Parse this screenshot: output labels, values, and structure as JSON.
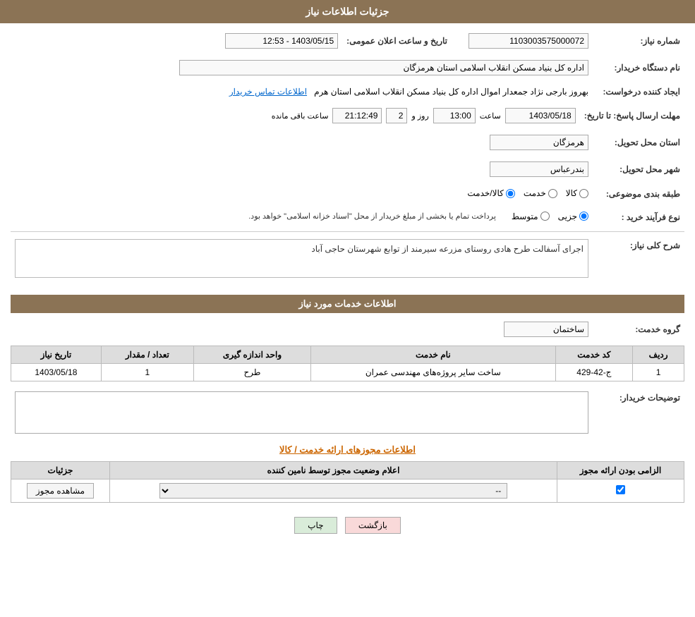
{
  "page": {
    "title": "جزئیات اطلاعات نیاز"
  },
  "header": {
    "title": "جزئیات اطلاعات نیاز"
  },
  "fields": {
    "order_number_label": "شماره نیاز:",
    "order_number_value": "1103003575000072",
    "announcement_label": "تاریخ و ساعت اعلان عمومی:",
    "announcement_value": "1403/05/15 - 12:53",
    "buyer_org_label": "نام دستگاه خریدار:",
    "buyer_org_value": "اداره کل بنیاد مسکن انقلاب اسلامی استان هرمزگان",
    "creator_label": "ایجاد کننده درخواست:",
    "creator_value": "بهروز  بارجی نژاد جمعدار اموال اداره کل بنیاد مسکن انقلاب اسلامی استان هرم",
    "creator_link": "اطلاعات تماس خریدار",
    "deadline_label": "مهلت ارسال پاسخ: تا تاریخ:",
    "deadline_date": "1403/05/18",
    "deadline_time_label": "ساعت",
    "deadline_time": "13:00",
    "deadline_days_label": "روز و",
    "deadline_days": "2",
    "deadline_remaining_label": "ساعت باقی مانده",
    "deadline_remaining": "21:12:49",
    "province_label": "استان محل تحویل:",
    "province_value": "هرمزگان",
    "city_label": "شهر محل تحویل:",
    "city_value": "بندرعباس",
    "category_label": "طبقه بندی موضوعی:",
    "category_kala": "کالا",
    "category_khadamat": "خدمت",
    "category_kala_khadamat": "کالا/خدمت",
    "category_selected": "kala_khadamat",
    "purchase_type_label": "نوع فرآیند خرید :",
    "purchase_jozyi": "جزیی",
    "purchase_motavaset": "متوسط",
    "purchase_note": "پرداخت تمام یا بخشی از مبلغ خریدار از محل \"اسناد خزانه اسلامی\" خواهد بود.",
    "description_label": "شرح کلی نیاز:",
    "description_value": "اجرای آسفالت طرح هادی روستای  مزرعه سیرمند از توابع شهرستان حاجی آباد"
  },
  "services_section": {
    "title": "اطلاعات خدمات مورد نیاز",
    "service_group_label": "گروه خدمت:",
    "service_group_value": "ساختمان",
    "table": {
      "headers": [
        "ردیف",
        "کد خدمت",
        "نام خدمت",
        "واحد اندازه گیری",
        "تعداد / مقدار",
        "تاریخ نیاز"
      ],
      "rows": [
        {
          "row": "1",
          "code": "ج-42-429",
          "name": "ساخت سایر پروژه‌های مهندسی عمران",
          "unit": "طرح",
          "count": "1",
          "date": "1403/05/18"
        }
      ]
    }
  },
  "buyer_description_label": "توضیحات خریدار:",
  "permits_section": {
    "title": "اطلاعات مجوزهای ارائه خدمت / کالا",
    "table": {
      "headers": [
        "الزامی بودن ارائه مجوز",
        "اعلام وضعیت مجوز توسط نامین کننده",
        "جزئیات"
      ],
      "rows": [
        {
          "required": true,
          "status": "--",
          "details_btn": "مشاهده مجوز"
        }
      ]
    }
  },
  "buttons": {
    "print": "چاپ",
    "back": "بازگشت"
  }
}
